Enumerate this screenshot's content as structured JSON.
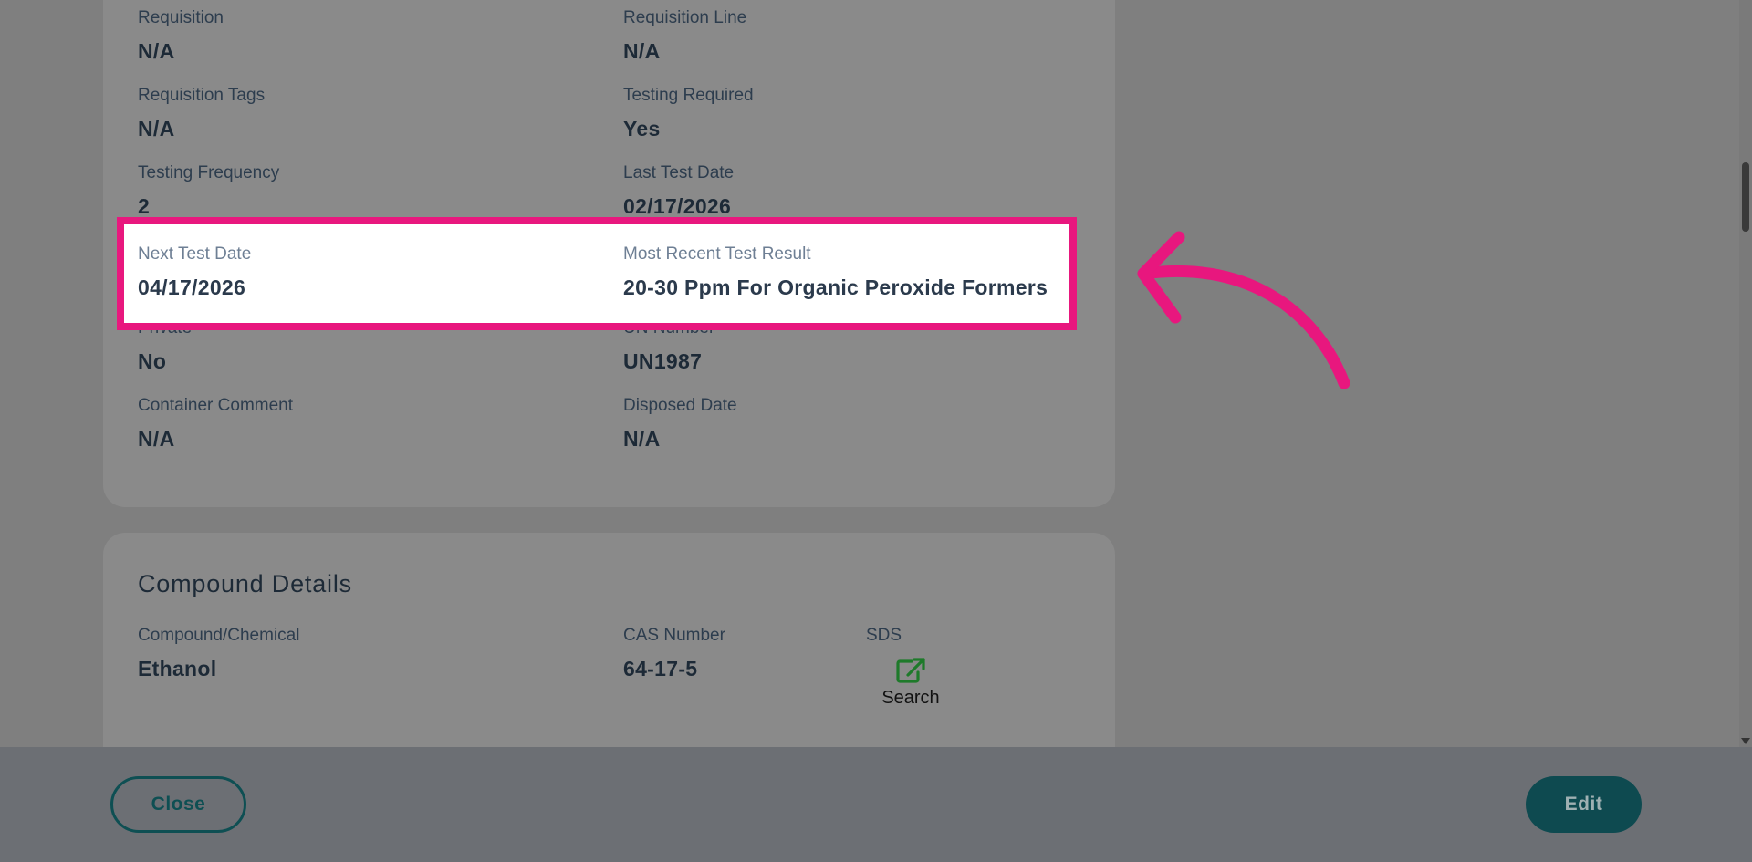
{
  "details": {
    "fields": [
      {
        "label": "Requisition",
        "value": "N/A"
      },
      {
        "label": "Requisition Line",
        "value": "N/A"
      },
      {
        "label": "Requisition Tags",
        "value": "N/A"
      },
      {
        "label": "Testing Required",
        "value": "Yes"
      },
      {
        "label": "Testing Frequency",
        "value": "2"
      },
      {
        "label": "Last Test Date",
        "value": "02/17/2026"
      },
      {
        "label": "Next Test Date",
        "value": "04/17/2026"
      },
      {
        "label": "Most Recent Test Result",
        "value": "20-30 Ppm For Organic Peroxide Formers"
      },
      {
        "label": "Private",
        "value": "No"
      },
      {
        "label": "UN Number",
        "value": "UN1987"
      },
      {
        "label": "Container Comment",
        "value": "N/A"
      },
      {
        "label": "Disposed Date",
        "value": "N/A"
      }
    ]
  },
  "compound": {
    "title": "Compound Details",
    "fields": [
      {
        "label": "Compound/Chemical",
        "value": "Ethanol"
      },
      {
        "label": "CAS Number",
        "value": "64-17-5"
      }
    ],
    "sds_label": "SDS",
    "sds_link_text": "Search",
    "sds_icon": "external-link-icon"
  },
  "footer": {
    "close_label": "Close",
    "edit_label": "Edit"
  },
  "colors": {
    "highlight": "#e8177e",
    "primary": "#0e4a50",
    "sds_icon": "#1e7a2a"
  }
}
